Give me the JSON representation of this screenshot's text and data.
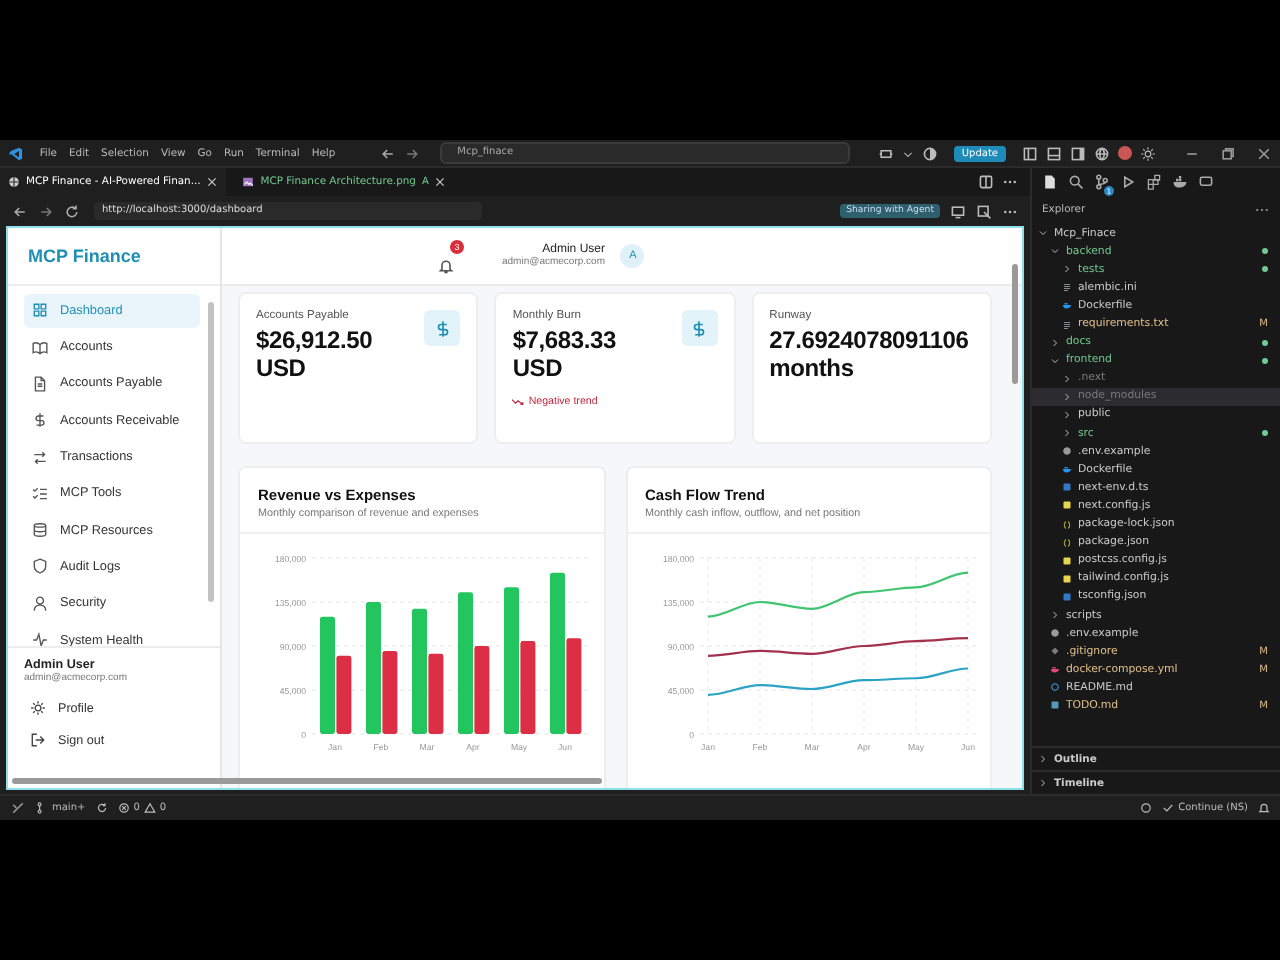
{
  "titlebar": {
    "menu": [
      "File",
      "Edit",
      "Selection",
      "View",
      "Go",
      "Run",
      "Terminal",
      "Help"
    ],
    "search": "Mcp_finace",
    "update_button": "Update"
  },
  "editor_tabs": [
    {
      "label": "MCP Finance - AI-Powered Finan...",
      "kind": "web",
      "selected": true
    },
    {
      "label": "MCP Finance Architecture.png",
      "kind": "image",
      "status": "A",
      "selected": false
    }
  ],
  "browser": {
    "url": "http://localhost:3000/dashboard",
    "sharing_badge": "Sharing with Agent"
  },
  "app": {
    "brand": "MCP Finance",
    "nav": [
      {
        "label": "Dashboard",
        "kind": "grid",
        "selected": true
      },
      {
        "label": "Accounts",
        "kind": "book",
        "selected": false
      },
      {
        "label": "Accounts Payable",
        "kind": "file",
        "selected": false
      },
      {
        "label": "Accounts Receivable",
        "kind": "dollar",
        "selected": false
      },
      {
        "label": "Transactions",
        "kind": "arrows",
        "selected": false
      },
      {
        "label": "MCP Tools",
        "kind": "list",
        "selected": false
      },
      {
        "label": "MCP Resources",
        "kind": "database",
        "selected": false
      },
      {
        "label": "Audit Logs",
        "kind": "shield",
        "selected": false
      },
      {
        "label": "Security",
        "kind": "user",
        "selected": false
      },
      {
        "label": "System Health",
        "kind": "activity",
        "selected": false
      }
    ],
    "user": {
      "name": "Admin User",
      "email": "admin@acmecorp.com"
    },
    "footer_links": [
      {
        "label": "Profile",
        "kind": "gear"
      },
      {
        "label": "Sign out",
        "kind": "logout"
      }
    ],
    "header": {
      "notifications": "3",
      "user_name": "Admin User",
      "user_email": "admin@acmecorp.com",
      "avatar": "A"
    },
    "stats": [
      {
        "label": "Accounts Payable",
        "value": "$26,912.50 USD",
        "kind": "currency"
      },
      {
        "label": "Monthly Burn",
        "value": "$7,683.33 USD",
        "kind": "currency",
        "trend": "Negative trend"
      },
      {
        "label": "Runway",
        "value": "27.6924078091106 months",
        "kind": "duration"
      }
    ],
    "charts": [
      {
        "title": "Revenue vs Expenses",
        "subtitle": "Monthly comparison of revenue and expenses",
        "chart_data": {
          "type": "bar",
          "grid": true,
          "categories": [
            "Jan",
            "Feb",
            "Mar",
            "Apr",
            "May",
            "Jun"
          ],
          "ylim": [
            0,
            180000
          ],
          "yticks": [
            {
              "value": 0,
              "label": "0"
            },
            {
              "value": 45000,
              "label": "45,000"
            },
            {
              "value": 90000,
              "label": "90,000"
            },
            {
              "value": 135000,
              "label": "135,000"
            },
            {
              "value": 180000,
              "label": "180,000"
            }
          ],
          "series": [
            {
              "color": "#22c55e",
              "values": [
                120000,
                135000,
                128000,
                145000,
                150000,
                165000
              ]
            },
            {
              "color": "#dc2f45",
              "values": [
                80000,
                85000,
                82000,
                90000,
                95000,
                98000
              ]
            }
          ]
        }
      },
      {
        "title": "Cash Flow Trend",
        "subtitle": "Monthly cash inflow, outflow, and net position",
        "chart_data": {
          "type": "line",
          "grid": true,
          "categories": [
            "Jan",
            "Feb",
            "Mar",
            "Apr",
            "May",
            "Jun"
          ],
          "ylim": [
            0,
            180000
          ],
          "yticks": [
            {
              "value": 0,
              "label": "0"
            },
            {
              "value": 45000,
              "label": "45,000"
            },
            {
              "value": 90000,
              "label": "90,000"
            },
            {
              "value": 135000,
              "label": "135,000"
            },
            {
              "value": 180000,
              "label": "180,000"
            }
          ],
          "series": [
            {
              "color": "#3fc46f",
              "values": [
                120000,
                135000,
                128000,
                145000,
                150000,
                165000
              ]
            },
            {
              "color": "#a3304e",
              "values": [
                80000,
                85000,
                82000,
                90000,
                95000,
                98000
              ]
            },
            {
              "color": "#2aa3c4",
              "values": [
                40000,
                50000,
                46000,
                55000,
                57000,
                67000
              ]
            }
          ]
        }
      }
    ]
  },
  "explorer": {
    "title": "Explorer",
    "scm_badge": "1",
    "tree": [
      {
        "name": "Mcp_Finace",
        "kind": "folder",
        "expanded": true,
        "color": "#cccccc",
        "dot": false,
        "selected": false,
        "children": [
          {
            "name": "backend",
            "kind": "folder",
            "expanded": true,
            "color": "#73c991",
            "dot": true,
            "selected": false,
            "children": [
              {
                "name": "tests",
                "kind": "folder",
                "expanded": false,
                "color": "#73c991",
                "dot": true,
                "selected": false
              },
              {
                "name": "alembic.ini",
                "kind": "lines",
                "color": "#cccccc",
                "dot": false,
                "selected": false
              },
              {
                "name": "Dockerfile",
                "kind": "docker",
                "color": "#cccccc",
                "dot": false,
                "selected": false
              },
              {
                "name": "requirements.txt",
                "kind": "lines",
                "color": "#e2c08d",
                "badge": "M",
                "dot": false,
                "selected": false
              }
            ]
          },
          {
            "name": "docs",
            "kind": "folder",
            "expanded": false,
            "color": "#73c991",
            "dot": true,
            "selected": false
          },
          {
            "name": "frontend",
            "kind": "folder",
            "expanded": true,
            "color": "#73c991",
            "dot": true,
            "selected": false,
            "children": [
              {
                "name": ".next",
                "kind": "folder",
                "expanded": false,
                "color": "#7a7a7a",
                "dot": false,
                "selected": false
              },
              {
                "name": "node_modules",
                "kind": "folder",
                "expanded": false,
                "color": "#7a7a7a",
                "dot": false,
                "selected": true
              },
              {
                "name": "public",
                "kind": "folder",
                "expanded": false,
                "color": "#cccccc",
                "dot": false,
                "selected": false
              },
              {
                "name": "src",
                "kind": "folder",
                "expanded": false,
                "color": "#73c991",
                "dot": true,
                "selected": false
              },
              {
                "name": ".env.example",
                "kind": "gear",
                "color": "#cccccc",
                "dot": false,
                "selected": false
              },
              {
                "name": "Dockerfile",
                "kind": "docker",
                "color": "#cccccc",
                "dot": false,
                "selected": false
              },
              {
                "name": "next-env.d.ts",
                "kind": "ts",
                "color": "#cccccc",
                "dot": false,
                "selected": false
              },
              {
                "name": "next.config.js",
                "kind": "js",
                "color": "#cccccc",
                "dot": false,
                "selected": false
              },
              {
                "name": "package-lock.json",
                "kind": "json",
                "color": "#cccccc",
                "dot": false,
                "selected": false
              },
              {
                "name": "package.json",
                "kind": "json",
                "color": "#cccccc",
                "dot": false,
                "selected": false
              },
              {
                "name": "postcss.config.js",
                "kind": "js",
                "color": "#cccccc",
                "dot": false,
                "selected": false
              },
              {
                "name": "tailwind.config.js",
                "kind": "js",
                "color": "#cccccc",
                "dot": false,
                "selected": false
              },
              {
                "name": "tsconfig.json",
                "kind": "ts",
                "color": "#cccccc",
                "dot": false,
                "selected": false
              }
            ]
          },
          {
            "name": "scripts",
            "kind": "folder",
            "expanded": false,
            "color": "#cccccc",
            "dot": false,
            "selected": false
          },
          {
            "name": ".env.example",
            "kind": "gear",
            "color": "#cccccc",
            "dot": false,
            "selected": false
          },
          {
            "name": ".gitignore",
            "kind": "git",
            "color": "#e2c08d",
            "badge": "M",
            "dot": false,
            "selected": false
          },
          {
            "name": "docker-compose.yml",
            "kind": "compose",
            "color": "#e2c08d",
            "badge": "M",
            "dot": false,
            "selected": false
          },
          {
            "name": "README.md",
            "kind": "info",
            "color": "#cccccc",
            "dot": false,
            "selected": false
          },
          {
            "name": "TODO.md",
            "kind": "md",
            "color": "#e2c08d",
            "badge": "M",
            "dot": false,
            "selected": false
          }
        ]
      }
    ],
    "sections": [
      {
        "label": "Outline",
        "expanded": false
      },
      {
        "label": "Timeline",
        "expanded": false
      }
    ]
  },
  "status_bar": {
    "branch": "main+",
    "errors": "0",
    "warnings": "0",
    "agent": "Continue (NS)"
  }
}
